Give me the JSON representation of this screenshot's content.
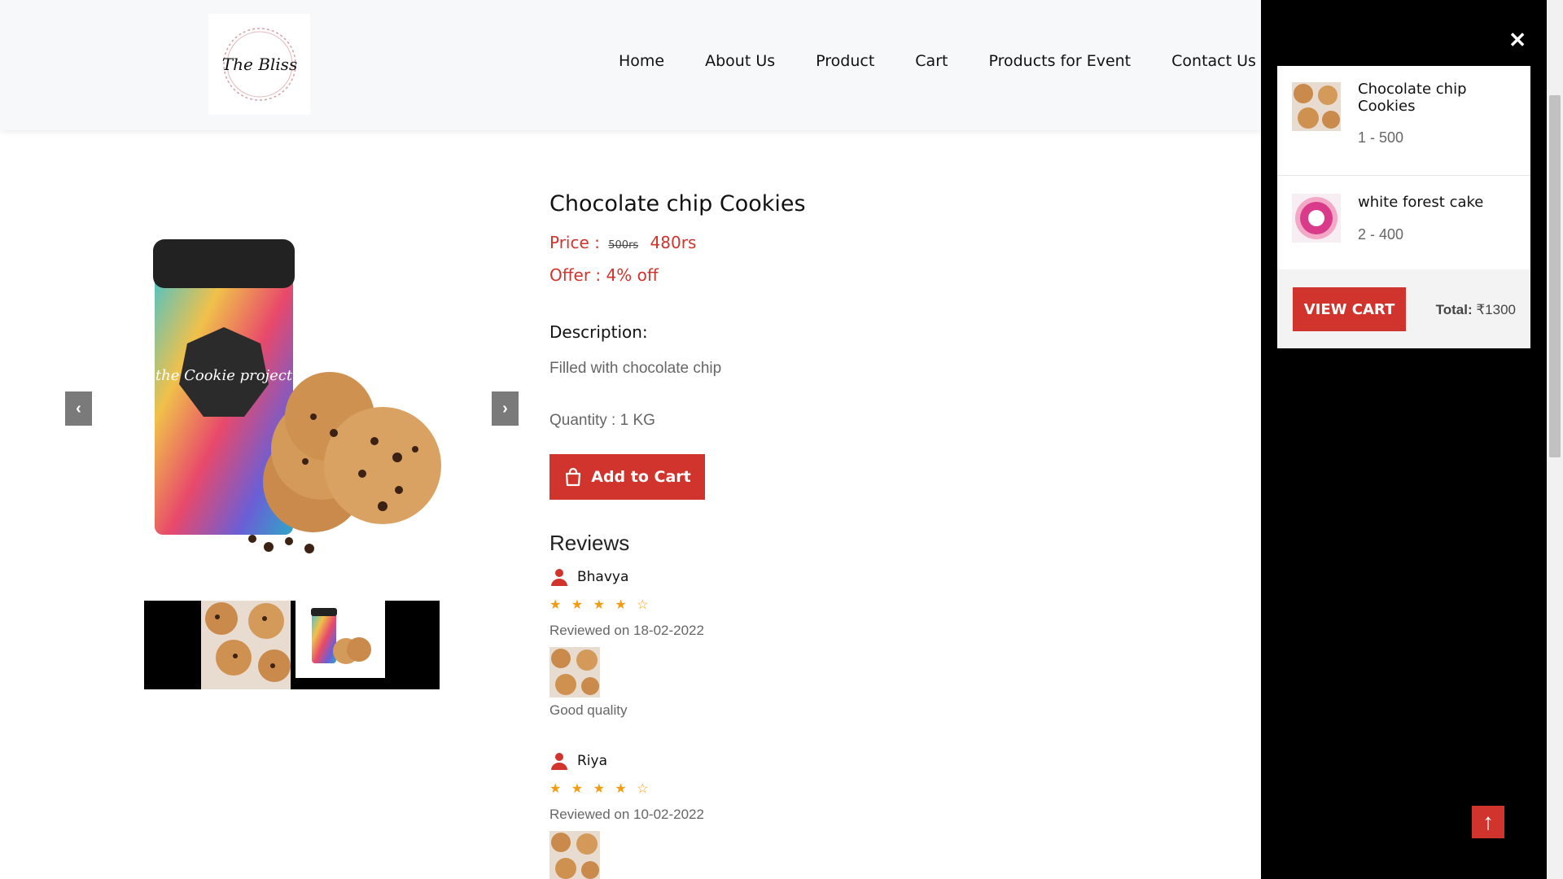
{
  "header": {
    "logo_text": "The Bliss",
    "nav": [
      "Home",
      "About Us",
      "Product",
      "Cart",
      "Products for Event",
      "Contact Us"
    ]
  },
  "product": {
    "title": "Chocolate chip Cookies",
    "price_label": "Price :",
    "old_price": "500rs",
    "new_price": "480rs",
    "offer": "Offer : 4% off",
    "description_label": "Description:",
    "description": "Filled with chocolate chip",
    "quantity": "Quantity : 1 KG",
    "add_to_cart": "Add to Cart",
    "jar_text": "the Cookie project"
  },
  "reviews": {
    "title": "Reviews",
    "items": [
      {
        "name": "Bhavya",
        "stars": "★ ★ ★ ★ ☆",
        "rating": 4,
        "date": "Reviewed on 18-02-2022",
        "text": "Good quality"
      },
      {
        "name": "Riya",
        "stars": "★ ★ ★ ★ ☆",
        "rating": 4,
        "date": "Reviewed on 10-02-2022",
        "text": ""
      }
    ]
  },
  "side_cart": {
    "items": [
      {
        "name": "Chocolate chip Cookies",
        "qty": "1 - 500"
      },
      {
        "name": "white forest cake",
        "qty": "2 - 400"
      }
    ],
    "view_cart": "VIEW CART",
    "total_label": "Total:",
    "total_value": "₹1300"
  },
  "icons": {
    "close": "close-icon",
    "prev": "chevron-left-icon",
    "next": "chevron-right-icon",
    "bag": "shopping-bag-icon",
    "user": "user-icon",
    "up": "arrow-up-icon"
  },
  "colors": {
    "accent": "#d0342c",
    "star": "#f39c12",
    "side_bg": "#000000"
  }
}
